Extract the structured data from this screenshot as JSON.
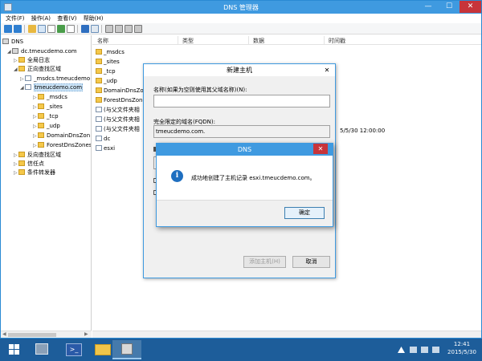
{
  "window": {
    "title": "DNS 管理器",
    "controls": {
      "minimize": "—",
      "maximize": "☐",
      "close": "✕"
    }
  },
  "menu": [
    "文件(F)",
    "操作(A)",
    "查看(V)",
    "帮助(H)"
  ],
  "tree": {
    "root": "DNS",
    "server": "dc.tmeucdemo.com",
    "global_logs": "全局日志",
    "forward_zones": "正向查找区域",
    "msdcs_zone": "_msdcs.tmeucdemo",
    "zone": "tmeucdemo.com",
    "subfolders": [
      "_msdcs",
      "_sites",
      "_tcp",
      "_udp",
      "DomainDnsZon",
      "ForestDnsZones"
    ],
    "reverse_zones": "反向查找区域",
    "trust_points": "信任点",
    "conditional_forwarders": "条件转发器"
  },
  "list": {
    "columns": [
      "名称",
      "类型",
      "数据",
      "时间戳"
    ],
    "rows": [
      "_msdcs",
      "_sites",
      "_tcp",
      "_udp",
      "DomainDnsZo",
      "ForestDnsZone",
      "(与父文件夹相",
      "(与父文件夹相",
      "(与父文件夹相",
      "dc",
      "esxi"
    ],
    "timestamp_value": "5/5/30 12:00:00"
  },
  "new_host_dialog": {
    "title": "新建主机",
    "close": "✕",
    "name_label": "名称(如果为空则使用其父域名称)(N):",
    "name_value": "",
    "fqdn_label": "完全限定的域名(FQDN):",
    "fqdn_value": "tmeucdemo.com.",
    "add_host_button": "添加主机(H)",
    "cancel_button": "取消"
  },
  "message_dialog": {
    "title": "DNS",
    "close": "✕",
    "icon_glyph": "i",
    "message": "成功地创建了主机记录 esxi.tmeucdemo.com。",
    "ok_button": "确定"
  },
  "taskbar": {
    "time": "12:41",
    "date": "2015/5/30"
  },
  "colors": {
    "title_bar": "#3f9ae0",
    "close_red": "#c7343a",
    "taskbar": "#1d5d9a"
  }
}
